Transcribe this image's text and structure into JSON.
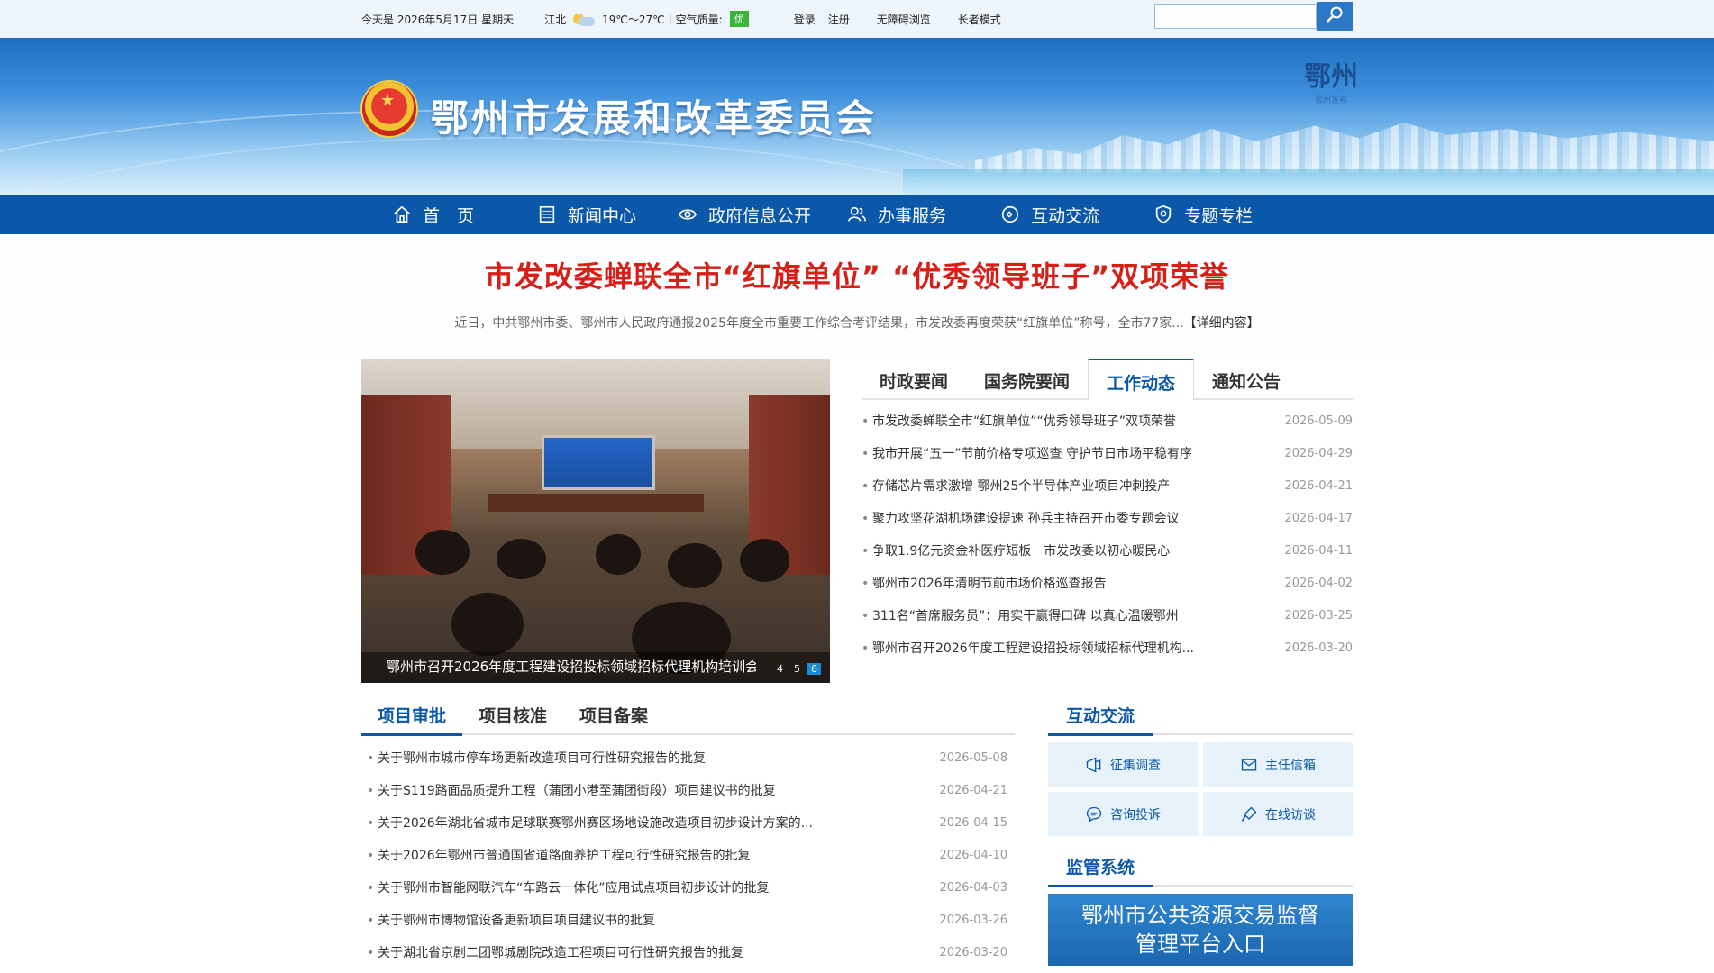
{
  "topbar": {
    "date": "今天是 2026年5月17日 星期天",
    "city": "江北",
    "temp": "19℃～27℃",
    "aq_label": "空气质量:",
    "aq_value": "优",
    "login": "登录",
    "register": "注册",
    "accessible": "无障碍浏览",
    "elder": "长者模式",
    "search_placeholder": ""
  },
  "banner": {
    "title": "鄂州市发展和改革委员会",
    "logo_text": "鄂州",
    "logo_sub": "鄂州发布"
  },
  "nav": [
    {
      "label": "首　页",
      "icon": "home-icon"
    },
    {
      "label": "新闻中心",
      "icon": "news-icon"
    },
    {
      "label": "政府信息公开",
      "icon": "eye-icon"
    },
    {
      "label": "办事服务",
      "icon": "people-icon"
    },
    {
      "label": "互动交流",
      "icon": "chat-icon"
    },
    {
      "label": "专题专栏",
      "icon": "badge-icon"
    }
  ],
  "headline": "市发改委蝉联全市“红旗单位” “优秀领导班子”双项荣誉",
  "summary": "近日，中共鄂州市委、鄂州市人民政府通报2025年度全市重要工作综合考评结果，市发改委再度荣获“红旗单位”称号，全市77家...",
  "summary_more": "【详细内容】",
  "slider": {
    "caption": "鄂州市召开2026年度工程建设招投标领域招标代理机构培训会",
    "dots": [
      "4",
      "5",
      "6"
    ],
    "active_dot": "6"
  },
  "news_tabs": [
    "时政要闻",
    "国务院要闻",
    "工作动态",
    "通知公告"
  ],
  "news_active": "工作动态",
  "news": [
    {
      "title": "市发改委蝉联全市“红旗单位”“优秀领导班子”双项荣誉",
      "date": "2026-05-09"
    },
    {
      "title": "我市开展“五一”节前价格专项巡查 守护节日市场平稳有序",
      "date": "2026-04-29"
    },
    {
      "title": "存储芯片需求激增 鄂州25个半导体产业项目冲刺投产",
      "date": "2026-04-21"
    },
    {
      "title": "聚力攻坚花湖机场建设提速 孙兵主持召开市委专题会议",
      "date": "2026-04-17"
    },
    {
      "title": "争取1.9亿元资金补医疗短板　市发改委以初心暖民心",
      "date": "2026-04-11"
    },
    {
      "title": "鄂州市2026年清明节前市场价格巡查报告",
      "date": "2026-04-02"
    },
    {
      "title": "311名“首席服务员”：用实干赢得口碑 以真心温暖鄂州",
      "date": "2026-03-25"
    },
    {
      "title": "鄂州市召开2026年度工程建设招投标领域招标代理机构...",
      "date": "2026-03-20"
    }
  ],
  "proj_tabs": [
    "项目审批",
    "项目核准",
    "项目备案"
  ],
  "proj_active": "项目审批",
  "proj": [
    {
      "title": "关于鄂州市城市停车场更新改造项目可行性研究报告的批复",
      "date": "2026-05-08"
    },
    {
      "title": "关于S119路面品质提升工程（蒲团小港至蒲团街段）项目建议书的批复",
      "date": "2026-04-21"
    },
    {
      "title": "关于2026年湖北省城市足球联赛鄂州赛区场地设施改造项目初步设计方案的...",
      "date": "2026-04-15"
    },
    {
      "title": "关于2026年鄂州市普通国省道路面养护工程可行性研究报告的批复",
      "date": "2026-04-10"
    },
    {
      "title": "关于鄂州市智能网联汽车“车路云一体化”应用试点项目初步设计的批复",
      "date": "2026-04-03"
    },
    {
      "title": "关于鄂州市博物馆设备更新项目项目建议书的批复",
      "date": "2026-03-26"
    },
    {
      "title": "关于湖北省京剧二团鄂城剧院改造工程项目可行性研究报告的批复",
      "date": "2026-03-20"
    }
  ],
  "interact": {
    "title": "互动交流",
    "items": [
      {
        "label": "征集调查",
        "icon": "survey-icon"
      },
      {
        "label": "主任信箱",
        "icon": "mail-icon"
      },
      {
        "label": "咨询投诉",
        "icon": "message-icon"
      },
      {
        "label": "在线访谈",
        "icon": "microphone-icon"
      }
    ]
  },
  "supervise": {
    "title": "监管系统",
    "platform_line1": "鄂州市公共资源交易监督",
    "platform_line2": "管理平台入口"
  },
  "colors": {
    "nav_bg": "#0b58ab",
    "headline": "#d71f18",
    "accent": "#0b58ab"
  }
}
